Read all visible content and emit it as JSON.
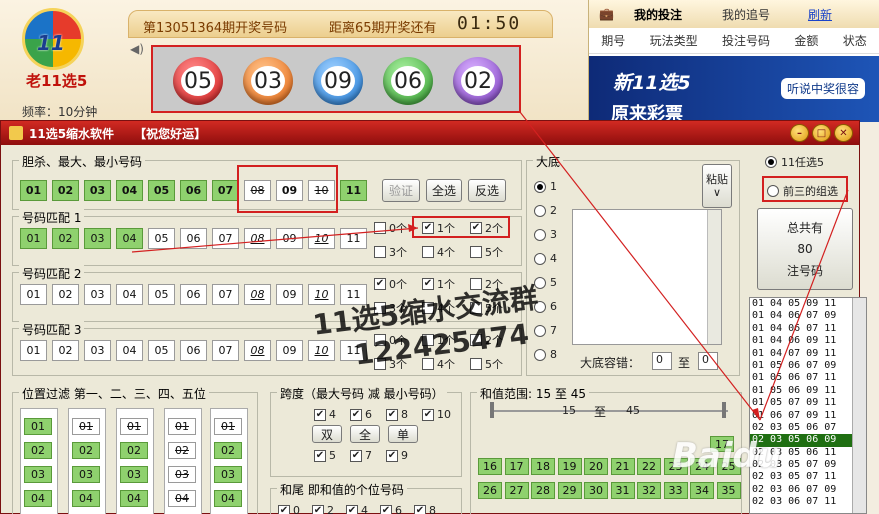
{
  "app": {
    "brand": "老11选5",
    "frequency": "频率：10分钟"
  },
  "draw": {
    "issue_text": "第13051364期开奖号码",
    "countdown_text": "距离65期开奖还有",
    "clock": "01:50",
    "balls": [
      "05",
      "03",
      "09",
      "06",
      "02"
    ]
  },
  "right": {
    "tabs": [
      "我的投注",
      "我的追号",
      "刷新"
    ],
    "columns": [
      "期号",
      "玩法类型",
      "投注号码",
      "金额",
      "状态"
    ],
    "banner_title": "新11选5",
    "banner_tag": "听说中奖很容",
    "banner_sub": "原来彩票"
  },
  "window": {
    "title": "11选5缩水软件",
    "greeting": "【祝您好运】"
  },
  "s1": {
    "legend": "胆杀、最大、最小号码",
    "nums": [
      "01",
      "02",
      "03",
      "04",
      "05",
      "06",
      "07",
      "08",
      "09",
      "10",
      "11"
    ],
    "verify": "验证",
    "select_all": "全选",
    "invert": "反选"
  },
  "s2": {
    "legend": "号码匹配 1",
    "nums": [
      "01",
      "02",
      "03",
      "04",
      "05",
      "06",
      "07",
      "08",
      "09",
      "10",
      "11"
    ],
    "checks": [
      "0个",
      "1个",
      "2个",
      "3个",
      "4个",
      "5个"
    ]
  },
  "s3": {
    "legend": "号码匹配 2",
    "nums": [
      "01",
      "02",
      "03",
      "04",
      "05",
      "06",
      "07",
      "08",
      "09",
      "10",
      "11"
    ],
    "checks": [
      "0个",
      "1个",
      "2个",
      "3个",
      "4个",
      "5个"
    ]
  },
  "s4": {
    "legend": "号码匹配 3",
    "nums": [
      "01",
      "02",
      "03",
      "04",
      "05",
      "06",
      "07",
      "08",
      "09",
      "10",
      "11"
    ],
    "checks": [
      "0个",
      "1个",
      "2个",
      "3个",
      "4个",
      "5个"
    ]
  },
  "dadi": {
    "legend": "大底",
    "radios": [
      "1",
      "2",
      "3",
      "4",
      "5",
      "6",
      "7",
      "8"
    ],
    "paste": "粘贴",
    "paste_arrow": "∨",
    "tol_label": "大底容错：",
    "tol_from": "0",
    "tol_to_label": "至",
    "tol_to": "0"
  },
  "mode": {
    "opt1": "11任选5",
    "opt2": "前三的组选"
  },
  "total": {
    "label": "总共有",
    "count": "80",
    "unit": "注号码"
  },
  "results": [
    "01 04 05 09 11",
    "01 04 06 07 09",
    "01 04 06 07 11",
    "01 04 06 09 11",
    "01 04 07 09 11",
    "01 05 06 07 09",
    "01 05 06 07 11",
    "01 05 06 09 11",
    "01 05 07 09 11",
    "01 06 07 09 11",
    "02 03 05 06 07",
    "02 03 05 06 09",
    "02 03 05 06 11",
    "02 03 05 07 09",
    "02 03 05 07 11",
    "02 03 06 07 09",
    "02 03 06 07 11"
  ],
  "selected_result": "02 03 05 06 09",
  "pos": {
    "legend": "位置过滤 第一、二、三、四、五位",
    "cols": [
      [
        "01",
        "02",
        "03",
        "04"
      ],
      [
        "01",
        "02",
        "03",
        "04"
      ],
      [
        "01",
        "02",
        "03",
        "04"
      ],
      [
        "01",
        "02",
        "03",
        "04"
      ],
      [
        "01",
        "02",
        "03",
        "04"
      ]
    ]
  },
  "span": {
    "legend": "跨度（最大号码 减 最小号码）",
    "vals": [
      "4",
      "6",
      "8",
      "10",
      "5",
      "7",
      "9"
    ],
    "btn_double": "双",
    "btn_all": "全",
    "btn_single": "单"
  },
  "tail": {
    "legend": "和尾 即和值的个位号码",
    "vals": [
      "0",
      "2",
      "4",
      "6",
      "8"
    ]
  },
  "sum": {
    "legend": "和值范围: 15 至 45",
    "from": "15",
    "to_label": "至",
    "to": "45",
    "row1": [
      "16",
      "17",
      "18",
      "19",
      "20",
      "21",
      "22",
      "23",
      "24",
      "25"
    ],
    "row2": [
      "26",
      "27",
      "28",
      "29",
      "30",
      "31",
      "32",
      "33",
      "34",
      "35"
    ],
    "corner": "17"
  },
  "overlay": {
    "line1": "11选5缩水交流群",
    "line2": "122425474",
    "logo": "Baidu"
  }
}
